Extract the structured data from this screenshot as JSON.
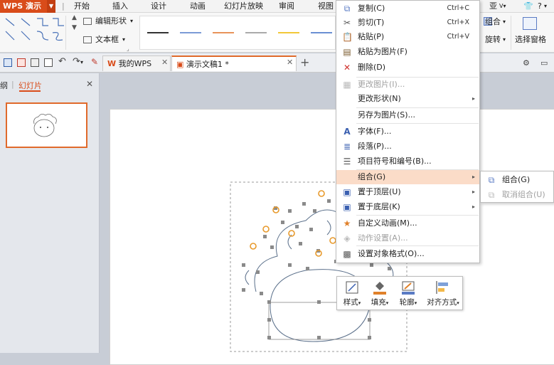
{
  "app": {
    "title": "WPS 演示"
  },
  "menu_tabs": [
    "开始",
    "插入",
    "设计",
    "动画",
    "幻灯片放映",
    "审阅",
    "视图"
  ],
  "top_right": {
    "account": "亚",
    "help": "?"
  },
  "ribbon": {
    "edit_shape": "编辑形状",
    "text_box": "文本框",
    "group": "组合",
    "rotate": "旋转",
    "selection_pane": "选择窗格"
  },
  "doc_tabs": [
    {
      "label": "我的WPS"
    },
    {
      "label": "演示文稿1 *"
    }
  ],
  "left_pane": {
    "outline_tab": "纲",
    "slides_tab": "幻灯片"
  },
  "context_menu": {
    "items": [
      {
        "label": "复制(C)",
        "shortcut": "Ctrl+C",
        "icon": "copy-icon",
        "disabled": false
      },
      {
        "label": "剪切(T)",
        "shortcut": "Ctrl+X",
        "icon": "scissors-icon",
        "disabled": false
      },
      {
        "label": "粘贴(P)",
        "shortcut": "Ctrl+V",
        "icon": "paste-icon",
        "disabled": false
      },
      {
        "label": "粘贴为图片(F)",
        "shortcut": "",
        "icon": "paste-image-icon",
        "disabled": false
      },
      {
        "label": "删除(D)",
        "shortcut": "",
        "icon": "delete-icon",
        "disabled": false
      },
      {
        "label": "更改图片(I)...",
        "shortcut": "",
        "icon": "change-picture-icon",
        "disabled": true
      },
      {
        "label": "更改形状(N)",
        "shortcut": "",
        "icon": "",
        "disabled": false,
        "submenu": true
      },
      {
        "label": "另存为图片(S)...",
        "shortcut": "",
        "icon": "",
        "disabled": false
      },
      {
        "label": "字体(F)...",
        "shortcut": "",
        "icon": "font-icon",
        "disabled": false
      },
      {
        "label": "段落(P)...",
        "shortcut": "",
        "icon": "paragraph-icon",
        "disabled": false
      },
      {
        "label": "项目符号和编号(B)...",
        "shortcut": "",
        "icon": "bullets-icon",
        "disabled": false
      },
      {
        "label": "组合(G)",
        "shortcut": "",
        "icon": "",
        "disabled": false,
        "submenu": true,
        "highlighted": true
      },
      {
        "label": "置于顶层(U)",
        "shortcut": "",
        "icon": "bring-front-icon",
        "disabled": false,
        "submenu": true
      },
      {
        "label": "置于底层(K)",
        "shortcut": "",
        "icon": "send-back-icon",
        "disabled": false,
        "submenu": true
      },
      {
        "label": "自定义动画(M)...",
        "shortcut": "",
        "icon": "animation-icon",
        "disabled": false
      },
      {
        "label": "动作设置(A)...",
        "shortcut": "",
        "icon": "action-icon",
        "disabled": true
      },
      {
        "label": "设置对象格式(O)...",
        "shortcut": "",
        "icon": "format-object-icon",
        "disabled": false
      }
    ]
  },
  "submenu": {
    "group": "组合(G)",
    "ungroup": "取消组合(U)"
  },
  "mini_toolbar": {
    "style": "样式",
    "fill": "填充",
    "outline": "轮廓",
    "align": "对齐方式"
  },
  "colors": {
    "brand": "#d94c1a",
    "highlight": "#fbdcc8",
    "selection": "#e06a2b"
  }
}
